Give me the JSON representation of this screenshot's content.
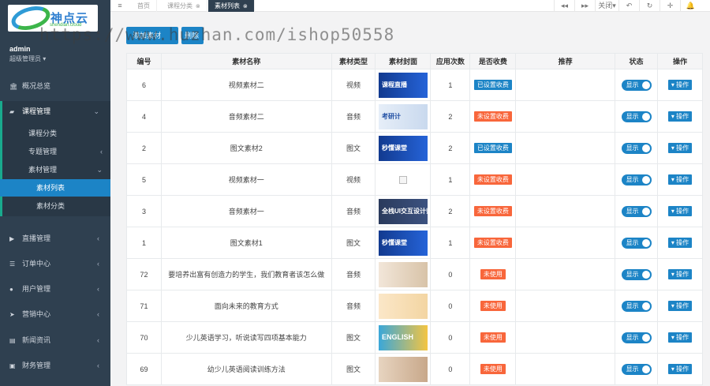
{
  "brand": {
    "name": "神点云",
    "sub": "shendian.cloud"
  },
  "user": {
    "name": "admin",
    "role": "超级管理员 ▾"
  },
  "menu": [
    {
      "label": "概况总览",
      "icon": "🏛"
    },
    {
      "label": "课程管理",
      "icon": "▰"
    },
    {
      "label": "直播管理",
      "icon": "▶"
    },
    {
      "label": "订单中心",
      "icon": "☰"
    },
    {
      "label": "用户管理",
      "icon": "●"
    },
    {
      "label": "营销中心",
      "icon": "➤"
    },
    {
      "label": "新闻资讯",
      "icon": "▤"
    },
    {
      "label": "财务管理",
      "icon": "▣"
    }
  ],
  "submenu": {
    "course_category": "课程分类",
    "topic": "专题管理",
    "material": "素材管理",
    "material_list": "素材列表",
    "material_category": "素材分类"
  },
  "tabs": [
    {
      "label": "首页"
    },
    {
      "label": "课程分类"
    },
    {
      "label": "素材列表"
    }
  ],
  "topbar": {
    "close_label": "关闭▾"
  },
  "actions": {
    "add_material": "添加素材",
    "delete": "删除"
  },
  "watermark": "https://www.huzhan.com/ishop50558",
  "table": {
    "headers": [
      "编号",
      "素材名称",
      "素材类型",
      "素材封面",
      "应用次数",
      "是否收费",
      "推荐",
      "状态",
      "操作"
    ],
    "status_label": "显示",
    "op_label": "▾ 操作",
    "rows": [
      {
        "id": "6",
        "name": "视频素材二",
        "type": "视频",
        "cover": "blue",
        "cover_text": "课程直播",
        "count": "1",
        "fee": "已设置收费",
        "fee_kind": "set"
      },
      {
        "id": "4",
        "name": "音频素材二",
        "type": "音频",
        "cover": "light",
        "cover_text": "考研计",
        "count": "2",
        "fee": "未设置收费",
        "fee_kind": "unset"
      },
      {
        "id": "2",
        "name": "图文素材2",
        "type": "图文",
        "cover": "blue",
        "cover_text": "秒懂课堂",
        "count": "2",
        "fee": "已设置收费",
        "fee_kind": "set"
      },
      {
        "id": "5",
        "name": "视频素材一",
        "type": "视频",
        "cover": "broken",
        "cover_text": "",
        "count": "1",
        "fee": "未设置收费",
        "fee_kind": "unset"
      },
      {
        "id": "3",
        "name": "音频素材一",
        "type": "音频",
        "cover": "navy",
        "cover_text": "全栈UI交互设计师",
        "count": "2",
        "fee": "未设置收费",
        "fee_kind": "unset"
      },
      {
        "id": "1",
        "name": "图文素材1",
        "type": "图文",
        "cover": "blue",
        "cover_text": "秒懂课堂",
        "count": "1",
        "fee": "未设置收费",
        "fee_kind": "unset"
      },
      {
        "id": "72",
        "name": "要培养出富有创造力的学生，我们教育者该怎么做",
        "type": "音频",
        "cover": "kids",
        "cover_text": "",
        "count": "0",
        "fee": "未使用",
        "fee_kind": "unused"
      },
      {
        "id": "71",
        "name": "面向未来的教育方式",
        "type": "音频",
        "cover": "kids2",
        "cover_text": "",
        "count": "0",
        "fee": "未使用",
        "fee_kind": "unused"
      },
      {
        "id": "70",
        "name": "少儿英语学习，听说读写四项基本能力",
        "type": "图文",
        "cover": "eng",
        "cover_text": "ENGLISH",
        "count": "0",
        "fee": "未使用",
        "fee_kind": "unused"
      },
      {
        "id": "69",
        "name": "幼少儿英语阅读训练方法",
        "type": "图文",
        "cover": "kids3",
        "cover_text": "",
        "count": "0",
        "fee": "未使用",
        "fee_kind": "unused"
      }
    ]
  }
}
